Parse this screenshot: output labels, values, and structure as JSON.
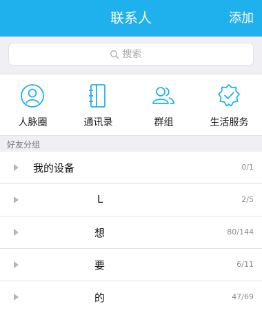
{
  "header": {
    "title": "联系人",
    "add_label": "添加"
  },
  "search": {
    "placeholder": "搜索",
    "icon": "search-icon"
  },
  "quick_actions": [
    {
      "label": "人脉圈",
      "icon": "person-circle-icon"
    },
    {
      "label": "通讯录",
      "icon": "address-book-icon"
    },
    {
      "label": "群组",
      "icon": "group-icon"
    },
    {
      "label": "生活服务",
      "icon": "verified-badge-icon"
    }
  ],
  "section": {
    "title": "好友分组"
  },
  "groups": [
    {
      "name": "我的设备",
      "count": "0/1"
    },
    {
      "name": "L",
      "count": "2/5"
    },
    {
      "name": "想",
      "count": "80/144"
    },
    {
      "name": "要",
      "count": "6/11"
    },
    {
      "name": "的",
      "count": "47/69"
    }
  ],
  "colors": {
    "header": "#1fb0ee",
    "icon": "#1fb0ee",
    "background": "#efeff4"
  }
}
